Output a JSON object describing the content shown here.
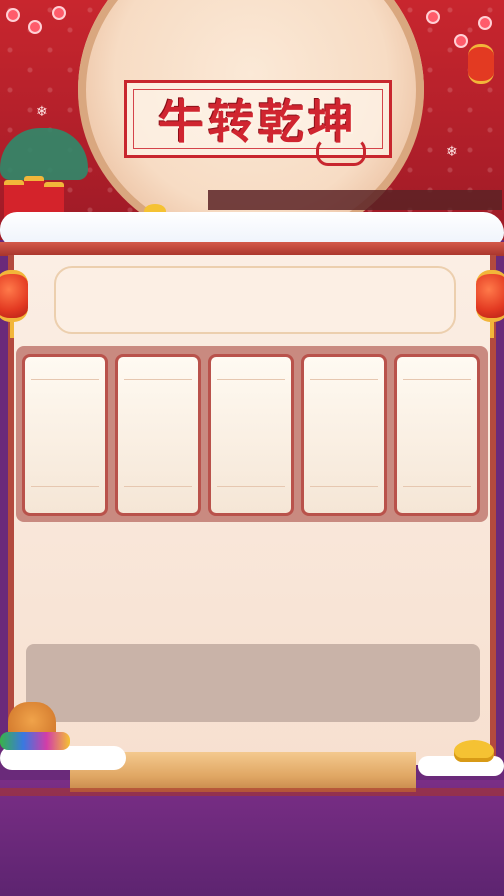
{
  "title": "牛转乾坤",
  "header_plaque": {
    "text": ""
  },
  "cards": [
    {
      "id": 1,
      "text": ""
    },
    {
      "id": 2,
      "text": ""
    },
    {
      "id": 3,
      "text": ""
    },
    {
      "id": 4,
      "text": ""
    },
    {
      "id": 5,
      "text": ""
    }
  ],
  "info_box": {
    "text": ""
  },
  "decorations": {
    "top_left": "plum-blossom-icon",
    "top_right": "plum-blossom-icon",
    "left_side": "lantern-icon",
    "right_side": "lantern-icon",
    "firecrackers": "firecracker-icon",
    "money_bag": "money-bag-icon",
    "gold_ingot": "gold-ingot-icon"
  },
  "colors": {
    "festive_red": "#c8262e",
    "panel_cream": "#fbeee4",
    "card_border": "#b9524b",
    "bottom_purple": "#6a2a7a",
    "gold": "#f5c233"
  }
}
